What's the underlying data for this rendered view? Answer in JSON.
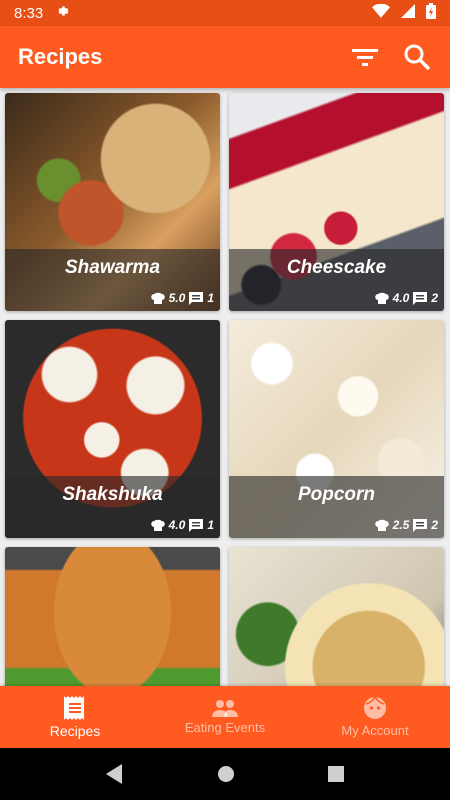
{
  "status_bar": {
    "time": "8:33"
  },
  "app_bar": {
    "title": "Recipes"
  },
  "recipes": [
    {
      "name": "Shawarma",
      "rating": "5.0",
      "comments": "1"
    },
    {
      "name": "Cheescake",
      "rating": "4.0",
      "comments": "2"
    },
    {
      "name": "Shakshuka",
      "rating": "4.0",
      "comments": "1"
    },
    {
      "name": "Popcorn",
      "rating": "2.5",
      "comments": "2"
    },
    {
      "name": "",
      "rating": "",
      "comments": ""
    },
    {
      "name": "",
      "rating": "",
      "comments": ""
    }
  ],
  "bottom_nav": [
    {
      "label": "Recipes",
      "icon": "receipt-icon",
      "active": true
    },
    {
      "label": "Eating Events",
      "icon": "people-icon",
      "active": false
    },
    {
      "label": "My Account",
      "icon": "face-icon",
      "active": false
    }
  ],
  "colors": {
    "primary": "#ff5a1f",
    "primary_dark": "#e84f15"
  }
}
